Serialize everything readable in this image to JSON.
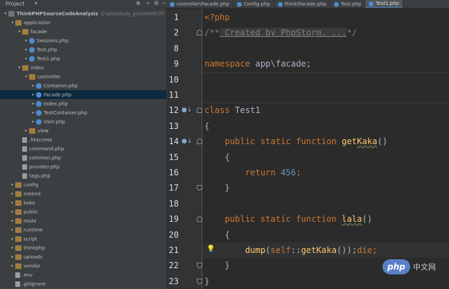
{
  "project_panel": {
    "title": "Project",
    "tree": [
      {
        "label": "ThinkPHPSourceCodeAnalysis",
        "path": "D:\\phpstudy_pro\\WWW\\Th",
        "type": "root",
        "depth": 0,
        "expanded": true
      },
      {
        "label": "application",
        "type": "folder",
        "depth": 1,
        "expanded": true
      },
      {
        "label": "facade",
        "type": "folder",
        "depth": 2,
        "expanded": true
      },
      {
        "label": "Sessions.php",
        "type": "php",
        "depth": 3,
        "expanded": false
      },
      {
        "label": "Test.php",
        "type": "php",
        "depth": 3,
        "expanded": false
      },
      {
        "label": "Test1.php",
        "type": "php",
        "depth": 3,
        "expanded": false
      },
      {
        "label": "index",
        "type": "folder",
        "depth": 2,
        "expanded": true
      },
      {
        "label": "controller",
        "type": "folder",
        "depth": 3,
        "expanded": true
      },
      {
        "label": "Container.php",
        "type": "php",
        "depth": 4,
        "expanded": false
      },
      {
        "label": "Facade.php",
        "type": "php",
        "depth": 4,
        "expanded": false,
        "selected": true
      },
      {
        "label": "Index.php",
        "type": "php",
        "depth": 4,
        "expanded": false
      },
      {
        "label": "TestContainer.php",
        "type": "php",
        "depth": 4,
        "expanded": false
      },
      {
        "label": "User.php",
        "type": "php",
        "depth": 4,
        "expanded": false
      },
      {
        "label": "view",
        "type": "folder",
        "depth": 3,
        "expanded": false
      },
      {
        "label": ".htaccess",
        "type": "file",
        "depth": 2,
        "leaf": true
      },
      {
        "label": "command.php",
        "type": "file",
        "depth": 2,
        "leaf": true
      },
      {
        "label": "common.php",
        "type": "file",
        "depth": 2,
        "leaf": true
      },
      {
        "label": "provider.php",
        "type": "file",
        "depth": 2,
        "leaf": true
      },
      {
        "label": "tags.php",
        "type": "file",
        "depth": 2,
        "leaf": true
      },
      {
        "label": "config",
        "type": "folder",
        "depth": 1,
        "expanded": false
      },
      {
        "label": "extend",
        "type": "folder",
        "depth": 1,
        "expanded": false
      },
      {
        "label": "kaka",
        "type": "folder",
        "depth": 1,
        "expanded": false
      },
      {
        "label": "public",
        "type": "folder",
        "depth": 1,
        "expanded": false
      },
      {
        "label": "route",
        "type": "folder",
        "depth": 1,
        "expanded": false
      },
      {
        "label": "runtime",
        "type": "folder",
        "depth": 1,
        "expanded": false
      },
      {
        "label": "script",
        "type": "folder",
        "depth": 1,
        "expanded": false
      },
      {
        "label": "thinkphp",
        "type": "folder",
        "depth": 1,
        "expanded": false
      },
      {
        "label": "uploads",
        "type": "folder",
        "depth": 1,
        "expanded": false
      },
      {
        "label": "vendor",
        "type": "folder",
        "depth": 1,
        "expanded": false
      },
      {
        "label": ".env",
        "type": "file",
        "depth": 1,
        "leaf": true
      },
      {
        "label": ".gitignore",
        "type": "file",
        "depth": 1,
        "leaf": true
      }
    ]
  },
  "tabs": [
    {
      "label": "controller\\Facade.php",
      "active": false
    },
    {
      "label": "Config.php",
      "active": false
    },
    {
      "label": "think\\Facade.php",
      "active": false
    },
    {
      "label": "Test.php",
      "active": false
    },
    {
      "label": "Test1.php",
      "active": true
    }
  ],
  "editor": {
    "current_line": 21,
    "lines": [
      {
        "no": "1",
        "tokens": [
          {
            "t": "<?php",
            "c": "tag"
          }
        ]
      },
      {
        "no": "2",
        "tokens": [
          {
            "t": "/**",
            "c": "cmt"
          },
          {
            "t": " Created by PhpStorm. ...",
            "c": "fold-cmt"
          },
          {
            "t": "*/",
            "c": "cmt"
          }
        ]
      },
      {
        "no": "8",
        "tokens": []
      },
      {
        "no": "9",
        "tokens": [
          {
            "t": "namespace",
            "c": "kw"
          },
          {
            "t": " app\\facade;",
            "c": "punc"
          }
        ]
      },
      {
        "no": "10",
        "tokens": []
      },
      {
        "no": "11",
        "tokens": []
      },
      {
        "no": "12",
        "tokens": [
          {
            "t": "class",
            "c": "kw"
          },
          {
            "t": " Test1",
            "c": "punc"
          }
        ]
      },
      {
        "no": "13",
        "tokens": [
          {
            "t": "{",
            "c": "punc"
          }
        ]
      },
      {
        "no": "14",
        "tokens": [
          {
            "t": "    public static function ",
            "c": "kw"
          },
          {
            "t": "get",
            "c": "fn"
          },
          {
            "t": "Kaka",
            "c": "fn typo"
          },
          {
            "t": "()",
            "c": "punc"
          }
        ]
      },
      {
        "no": "15",
        "tokens": [
          {
            "t": "    {",
            "c": "punc"
          }
        ]
      },
      {
        "no": "16",
        "tokens": [
          {
            "t": "        return ",
            "c": "kw"
          },
          {
            "t": "456",
            "c": "num"
          },
          {
            "t": ";",
            "c": "kw"
          }
        ]
      },
      {
        "no": "17",
        "tokens": [
          {
            "t": "    }",
            "c": "punc"
          }
        ]
      },
      {
        "no": "18",
        "tokens": []
      },
      {
        "no": "19",
        "tokens": [
          {
            "t": "    public static function ",
            "c": "kw"
          },
          {
            "t": "lala",
            "c": "fn typo"
          },
          {
            "t": "()",
            "c": "punc"
          }
        ]
      },
      {
        "no": "20",
        "tokens": [
          {
            "t": "    {",
            "c": "punc"
          }
        ]
      },
      {
        "no": "21",
        "tokens": [
          {
            "t": "        ",
            "c": "punc"
          },
          {
            "t": "dump",
            "c": "fn"
          },
          {
            "t": "(",
            "c": "punc"
          },
          {
            "t": "self",
            "c": "kw"
          },
          {
            "t": "::",
            "c": "punc"
          },
          {
            "t": "getKaka",
            "c": "fn"
          },
          {
            "t": "());",
            "c": "punc"
          },
          {
            "t": "die",
            "c": "kw"
          },
          {
            "t": ";",
            "c": "kw"
          }
        ]
      },
      {
        "no": "22",
        "tokens": [
          {
            "t": "    }",
            "c": "punc"
          }
        ]
      },
      {
        "no": "23",
        "tokens": [
          {
            "t": "}",
            "c": "punc"
          }
        ]
      }
    ]
  },
  "colors": {
    "keyword": "#cc7832",
    "function": "#ffc66d",
    "number": "#6897bb",
    "comment": "#808080",
    "text": "#a9b7c6",
    "background": "#2b2b2b"
  },
  "watermark": {
    "badge": "php",
    "text": "中文网"
  }
}
